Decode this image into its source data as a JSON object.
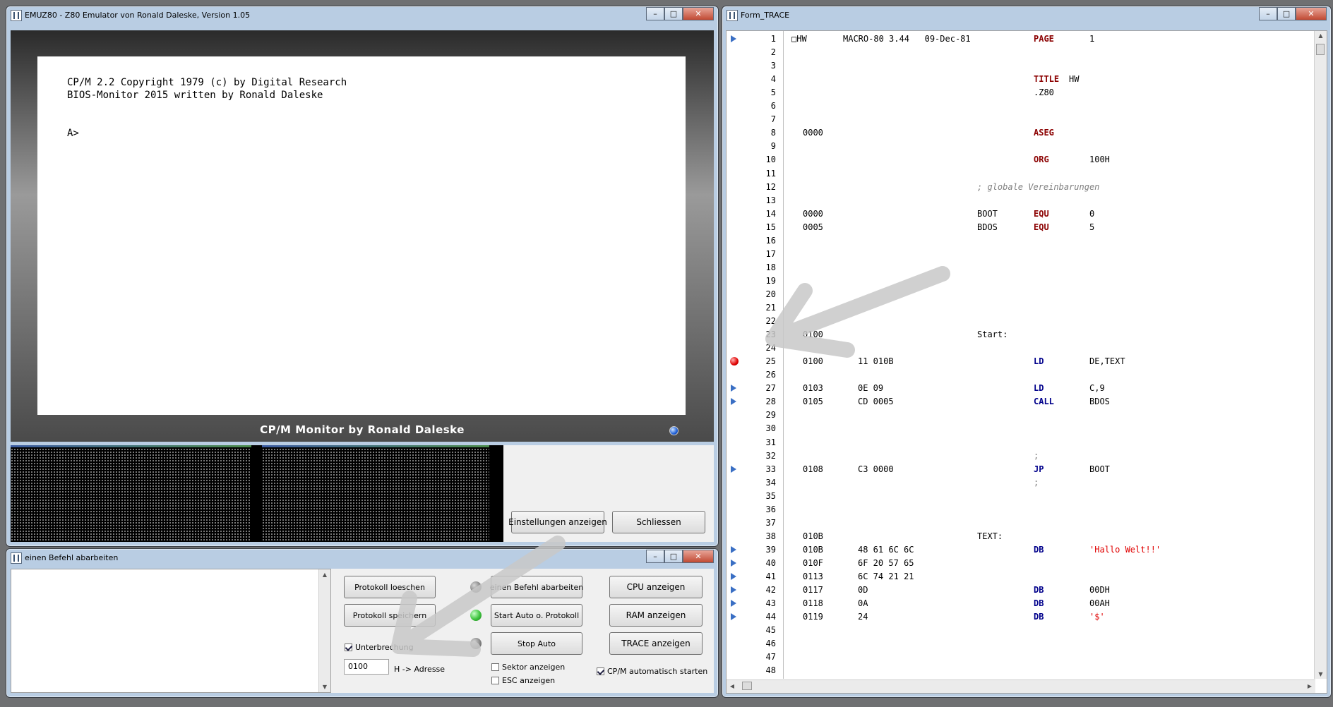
{
  "emu_window": {
    "title": "EMUZ80 - Z80 Emulator von Ronald Daleske, Version 1.05",
    "screen_lines": [
      "CP/M 2.2 Copyright 1979 (c) by Digital Research",
      "BIOS-Monitor 2015 written by Ronald Daleske",
      "",
      "",
      "A>"
    ],
    "monitor_label": "CP/M Monitor by Ronald Daleske",
    "btn_settings": "Einstellungen anzeigen",
    "btn_close": "Schliessen"
  },
  "cmd_window": {
    "title": "einen Befehl abarbeiten",
    "btn_protokoll_loeschen": "Protokoll loeschen",
    "btn_protokoll_speichern": "Protokoll speichern",
    "btn_einen_befehl": "einen Befehl abarbeiten",
    "btn_start_auto": "Start Auto o. Protokoll",
    "btn_stop_auto": "Stop Auto",
    "btn_cpu": "CPU anzeigen",
    "btn_ram": "RAM anzeigen",
    "btn_trace": "TRACE anzeigen",
    "cb_unterbrechung": "Unterbrechung",
    "cb_sektor": "Sektor anzeigen",
    "cb_esc": "ESC anzeigen",
    "cb_cpm": "CP/M automatisch starten",
    "address_value": "0100",
    "address_label": "H -> Adresse",
    "colors": {
      "led_off": "#808080",
      "led_on": "#3ec43e"
    }
  },
  "trace_window": {
    "title": "Form_TRACE",
    "lines": [
      {
        "n": "1",
        "a": "",
        "c": "",
        "l": "□HW",
        "o": "MACRO-80 3.44   09-Dec-81",
        "p": "PAGE",
        "m": "1",
        "mk": "arrow"
      },
      {
        "n": "2",
        "a": "",
        "c": "",
        "l": "",
        "o": "",
        "p": "",
        "m": "",
        "mk": ""
      },
      {
        "n": "3",
        "a": "",
        "c": "",
        "l": "",
        "o": "",
        "p": "",
        "m": "",
        "mk": ""
      },
      {
        "n": "4",
        "a": "",
        "c": "",
        "l": "",
        "o": "",
        "p": "TITLE",
        "m": "HW",
        "mk": ""
      },
      {
        "n": "5",
        "a": "",
        "c": "",
        "l": "",
        "o": "",
        "p": ".Z80",
        "m": "",
        "mk": ""
      },
      {
        "n": "6",
        "a": "",
        "c": "",
        "l": "",
        "o": "",
        "p": "",
        "m": "",
        "mk": ""
      },
      {
        "n": "7",
        "a": "",
        "c": "",
        "l": "",
        "o": "",
        "p": "",
        "m": "",
        "mk": ""
      },
      {
        "n": "8",
        "a": "0000",
        "c": "",
        "l": "",
        "o": "",
        "p": "ASEG",
        "m": "",
        "mk": ""
      },
      {
        "n": "9",
        "a": "",
        "c": "",
        "l": "",
        "o": "",
        "p": "",
        "m": "",
        "mk": ""
      },
      {
        "n": "10",
        "a": "",
        "c": "",
        "l": "",
        "o": "",
        "p": "ORG",
        "m": "100H",
        "mk": ""
      },
      {
        "n": "11",
        "a": "",
        "c": "",
        "l": "",
        "o": "",
        "p": "",
        "m": "",
        "mk": ""
      },
      {
        "n": "12",
        "a": "",
        "c": "",
        "l": "; globale Vereinbarungen",
        "o": "",
        "p": "",
        "m": "",
        "mk": ""
      },
      {
        "n": "13",
        "a": "",
        "c": "",
        "l": "",
        "o": "",
        "p": "",
        "m": "",
        "mk": ""
      },
      {
        "n": "14",
        "a": "0000",
        "c": "",
        "l": "BOOT",
        "o": "",
        "p": "EQU",
        "m": "0",
        "mk": ""
      },
      {
        "n": "15",
        "a": "0005",
        "c": "",
        "l": "BDOS",
        "o": "",
        "p": "EQU",
        "m": "5",
        "mk": ""
      },
      {
        "n": "16",
        "a": "",
        "c": "",
        "l": "",
        "o": "",
        "p": "",
        "m": "",
        "mk": ""
      },
      {
        "n": "17",
        "a": "",
        "c": "",
        "l": "",
        "o": "",
        "p": "",
        "m": "",
        "mk": ""
      },
      {
        "n": "18",
        "a": "",
        "c": "",
        "l": "",
        "o": "",
        "p": "",
        "m": "",
        "mk": ""
      },
      {
        "n": "19",
        "a": "",
        "c": "",
        "l": "",
        "o": "",
        "p": "",
        "m": "",
        "mk": ""
      },
      {
        "n": "20",
        "a": "",
        "c": "",
        "l": "",
        "o": "",
        "p": "",
        "m": "",
        "mk": ""
      },
      {
        "n": "21",
        "a": "",
        "c": "",
        "l": "",
        "o": "",
        "p": "",
        "m": "",
        "mk": ""
      },
      {
        "n": "22",
        "a": "",
        "c": "",
        "l": "",
        "o": "",
        "p": "",
        "m": "",
        "mk": ""
      },
      {
        "n": "23",
        "a": "0100",
        "c": "",
        "l": "Start:",
        "o": "",
        "p": "",
        "m": "",
        "mk": ""
      },
      {
        "n": "24",
        "a": "",
        "c": "",
        "l": "",
        "o": "",
        "p": "",
        "m": "",
        "mk": ""
      },
      {
        "n": "25",
        "a": "0100",
        "c": "11 010B",
        "l": "",
        "o": "",
        "p": "LD",
        "m": "DE,TEXT",
        "mk": "bp"
      },
      {
        "n": "26",
        "a": "",
        "c": "",
        "l": "",
        "o": "",
        "p": "",
        "m": "",
        "mk": ""
      },
      {
        "n": "27",
        "a": "0103",
        "c": "0E 09",
        "l": "",
        "o": "",
        "p": "LD",
        "m": "C,9",
        "mk": "arrow"
      },
      {
        "n": "28",
        "a": "0105",
        "c": "CD 0005",
        "l": "",
        "o": "",
        "p": "CALL",
        "m": "BDOS",
        "mk": "arrow"
      },
      {
        "n": "29",
        "a": "",
        "c": "",
        "l": "",
        "o": "",
        "p": "",
        "m": "",
        "mk": ""
      },
      {
        "n": "30",
        "a": "",
        "c": "",
        "l": "",
        "o": "",
        "p": "",
        "m": "",
        "mk": ""
      },
      {
        "n": "31",
        "a": "",
        "c": "",
        "l": "",
        "o": "",
        "p": "",
        "m": "",
        "mk": ""
      },
      {
        "n": "32",
        "a": "",
        "c": "",
        "l": "",
        "o": "",
        "p": ";",
        "m": "",
        "mk": ""
      },
      {
        "n": "33",
        "a": "0108",
        "c": "C3 0000",
        "l": "",
        "o": "",
        "p": "JP",
        "m": "BOOT",
        "mk": "arrow"
      },
      {
        "n": "34",
        "a": "",
        "c": "",
        "l": "",
        "o": "",
        "p": ";",
        "m": "",
        "mk": ""
      },
      {
        "n": "35",
        "a": "",
        "c": "",
        "l": "",
        "o": "",
        "p": "",
        "m": "",
        "mk": ""
      },
      {
        "n": "36",
        "a": "",
        "c": "",
        "l": "",
        "o": "",
        "p": "",
        "m": "",
        "mk": ""
      },
      {
        "n": "37",
        "a": "",
        "c": "",
        "l": "",
        "o": "",
        "p": "",
        "m": "",
        "mk": ""
      },
      {
        "n": "38",
        "a": "010B",
        "c": "",
        "l": "TEXT:",
        "o": "",
        "p": "",
        "m": "",
        "mk": ""
      },
      {
        "n": "39",
        "a": "010B",
        "c": "48 61 6C 6C",
        "l": "",
        "o": "",
        "p": "DB",
        "m": "'Hallo Welt!!'",
        "mk": "arrow"
      },
      {
        "n": "40",
        "a": "010F",
        "c": "6F 20 57 65",
        "l": "",
        "o": "",
        "p": "",
        "m": "",
        "mk": "arrow"
      },
      {
        "n": "41",
        "a": "0113",
        "c": "6C 74 21 21",
        "l": "",
        "o": "",
        "p": "",
        "m": "",
        "mk": "arrow"
      },
      {
        "n": "42",
        "a": "0117",
        "c": "0D",
        "l": "",
        "o": "",
        "p": "DB",
        "m": "00DH",
        "mk": "arrow"
      },
      {
        "n": "43",
        "a": "0118",
        "c": "0A",
        "l": "",
        "o": "",
        "p": "DB",
        "m": "00AH",
        "mk": "arrow"
      },
      {
        "n": "44",
        "a": "0119",
        "c": "24",
        "l": "",
        "o": "",
        "p": "DB",
        "m": "'$'",
        "mk": "arrow"
      },
      {
        "n": "45",
        "a": "",
        "c": "",
        "l": "",
        "o": "",
        "p": "",
        "m": "",
        "mk": ""
      },
      {
        "n": "46",
        "a": "",
        "c": "",
        "l": "",
        "o": "",
        "p": "",
        "m": "",
        "mk": ""
      },
      {
        "n": "47",
        "a": "",
        "c": "",
        "l": "",
        "o": "",
        "p": "",
        "m": "",
        "mk": ""
      },
      {
        "n": "48",
        "a": "",
        "c": "",
        "l": "",
        "o": "",
        "p": "",
        "m": "",
        "mk": ""
      }
    ],
    "colors": {
      "keyword": "#8b0000",
      "instr": "#00008b",
      "string": "#e00000",
      "comment": "#808080",
      "breakpoint": "#e00000",
      "marker": "#3a6fc4"
    }
  },
  "icons": [
    "app-icon",
    "minimize-icon",
    "maximize-icon",
    "close-icon",
    "breakpoint-icon",
    "trace-marker-icon",
    "scroll-up-icon",
    "scroll-down-icon"
  ]
}
